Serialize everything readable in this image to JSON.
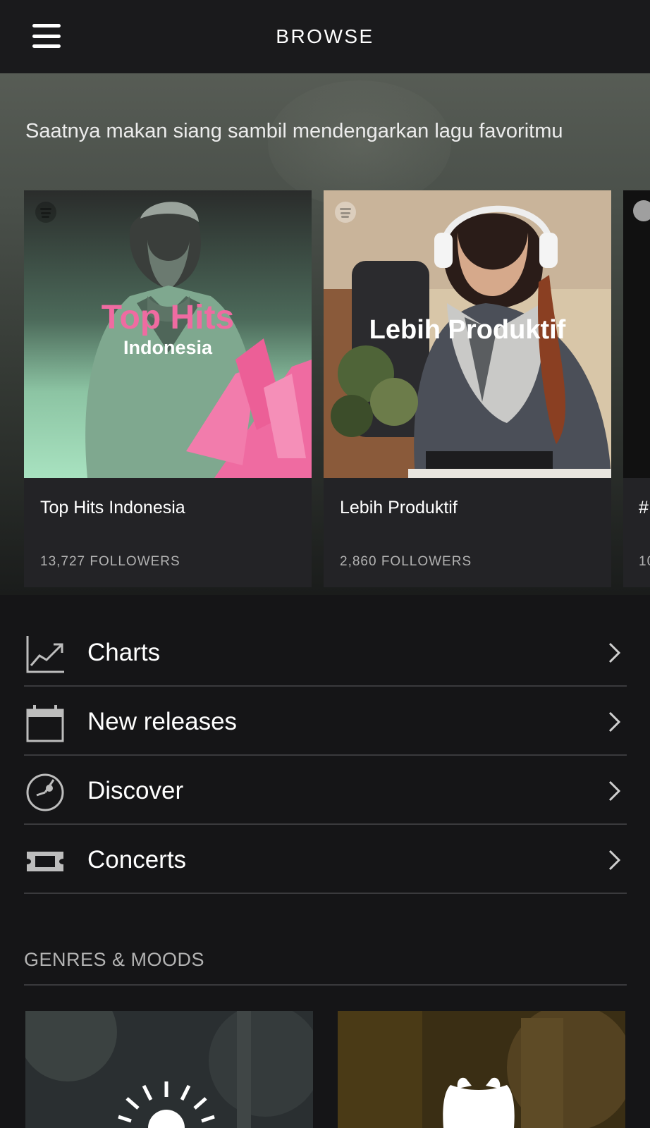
{
  "header": {
    "title": "BROWSE"
  },
  "hero": {
    "subtitle": "Saatnya makan siang sambil mendengarkan lagu favoritmu"
  },
  "playlists": [
    {
      "name": "Top Hits Indonesia",
      "followers": "13,727 FOLLOWERS",
      "art_title_1": "Top Hits",
      "art_title_2": "Indonesia"
    },
    {
      "name": "Lebih Produktif",
      "followers": "2,860 FOLLOWERS",
      "art_title": "Lebih Produktif"
    },
    {
      "name": "#",
      "followers": "10"
    }
  ],
  "menu": [
    {
      "label": "Charts",
      "icon": "chart-icon"
    },
    {
      "label": "New releases",
      "icon": "calendar-icon"
    },
    {
      "label": "Discover",
      "icon": "discover-icon"
    },
    {
      "label": "Concerts",
      "icon": "ticket-icon"
    }
  ],
  "genres": {
    "title": "GENRES & MOODS"
  },
  "colors": {
    "background": "#151517",
    "card": "#232326",
    "accent_pink": "#ef6ba1",
    "mint": "#a4e3bd"
  }
}
